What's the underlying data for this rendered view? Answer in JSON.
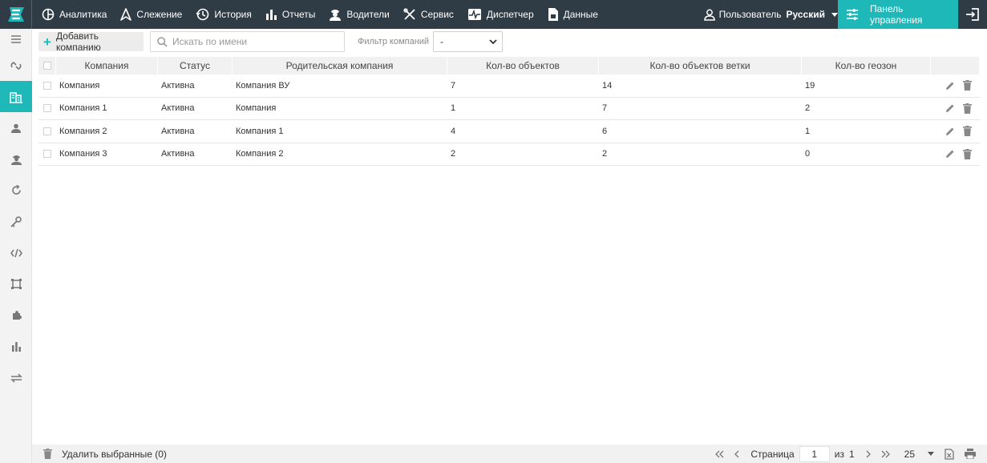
{
  "nav": {
    "items": [
      {
        "label": "Аналитика",
        "icon": "analytics-icon"
      },
      {
        "label": "Слежение",
        "icon": "tracking-icon"
      },
      {
        "label": "История",
        "icon": "history-icon"
      },
      {
        "label": "Отчеты",
        "icon": "reports-icon"
      },
      {
        "label": "Водители",
        "icon": "drivers-icon"
      },
      {
        "label": "Сервис",
        "icon": "service-icon"
      },
      {
        "label": "Диспетчер",
        "icon": "dispatcher-icon"
      },
      {
        "label": "Данные",
        "icon": "data-icon"
      }
    ],
    "user_label": "Пользователь",
    "language": "Русский",
    "panel_label": "Панель управления"
  },
  "colors": {
    "topbar": "#2f3b45",
    "accent": "#1fb8b8"
  },
  "toolbar": {
    "add_label": "Добавить компанию",
    "search_placeholder": "Искать по имени",
    "filter_label": "Фильтр компаний",
    "filter_value": "-"
  },
  "table": {
    "headers": [
      "Компания",
      "Статус",
      "Родительская компания",
      "Кол-во объектов",
      "Кол-во объектов ветки",
      "Кол-во геозон"
    ],
    "rows": [
      [
        "Компания",
        "Активна",
        "Компания ВУ",
        "7",
        "14",
        "19"
      ],
      [
        "Компания 1",
        "Активна",
        "Компания",
        "1",
        "7",
        "2"
      ],
      [
        "Компания 2",
        "Активна",
        "Компания 1",
        "4",
        "6",
        "1"
      ],
      [
        "Компания 3",
        "Активна",
        "Компания 2",
        "2",
        "2",
        "0"
      ]
    ]
  },
  "footer": {
    "delete_selected": "Удалить выбранные (0)",
    "page_label": "Страница",
    "page_value": "1",
    "of_label": "из",
    "total_pages": "1",
    "per_page": "25"
  }
}
